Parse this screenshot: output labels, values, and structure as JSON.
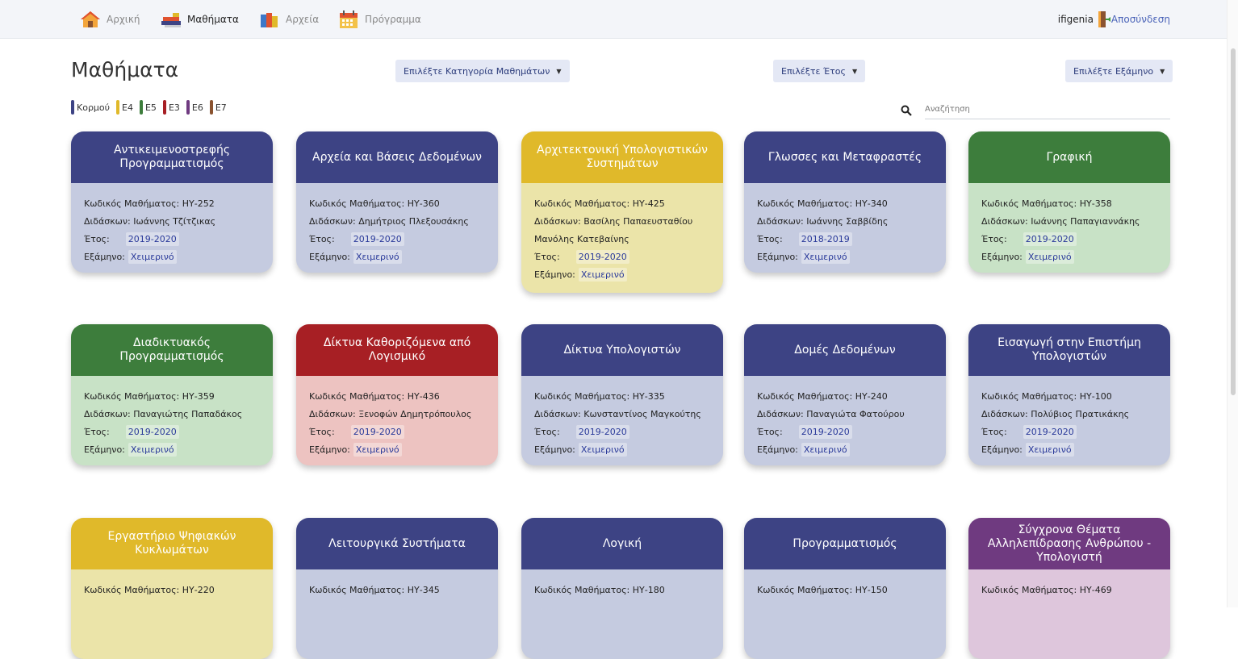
{
  "nav": {
    "items": [
      {
        "label": "Αρχική",
        "icon": "home-icon"
      },
      {
        "label": "Μαθήματα",
        "icon": "books-icon"
      },
      {
        "label": "Αρχεία",
        "icon": "files-icon"
      },
      {
        "label": "Πρόγραμμα",
        "icon": "calendar-icon"
      }
    ],
    "user": "ifigenia",
    "logout": "Αποσύνδεση"
  },
  "page": {
    "title": "Μαθήματα",
    "category_dropdown": "Επιλέξτε Κατηγορία Μαθημάτων",
    "year_dropdown": "Επιλέξτε Έτος",
    "semester_dropdown": "Επιλέξτε Εξάμηνο",
    "search_placeholder": "Αναζήτηση"
  },
  "legend": [
    {
      "label": "Κορμού",
      "color": "#3d4384"
    },
    {
      "label": "Ε4",
      "color": "#e0b92a"
    },
    {
      "label": "Ε5",
      "color": "#3d7d3c"
    },
    {
      "label": "Ε3",
      "color": "#a71f24"
    },
    {
      "label": "Ε6",
      "color": "#6f3a80"
    },
    {
      "label": "Ε7",
      "color": "#8a5330"
    }
  ],
  "labels": {
    "code": "Κωδικός Μαθήματος:",
    "teacher": "Διδάσκων:",
    "year": "Έτος:",
    "semester": "Εξάμηνο:"
  },
  "courses": [
    {
      "title": "Αντικειμενοστρεφής Προγραμματισμός",
      "code": "ΗΥ-252",
      "teacher": "Ιωάννης Τζίτζικας",
      "teacher2": "",
      "year": "2019-2020",
      "semester": "Χειμερινό",
      "head": "#3d4384",
      "body": "#c5cbe0"
    },
    {
      "title": "Αρχεία και Βάσεις Δεδομένων",
      "code": "ΗΥ-360",
      "teacher": "Δημήτριος Πλεξουσάκης",
      "teacher2": "",
      "year": "2019-2020",
      "semester": "Χειμερινό",
      "head": "#3d4384",
      "body": "#c5cbe0"
    },
    {
      "title": "Αρχιτεκτονική Υπολογιστικών Συστημάτων",
      "code": "ΗΥ-425",
      "teacher": "Βασίλης Παπαευσταθίου",
      "teacher2": "Μανόλης Κατεβαίνης",
      "year": "2019-2020",
      "semester": "Χειμερινό",
      "head": "#e0b92a",
      "body": "#ebe4a9"
    },
    {
      "title": "Γλωσσες και Μεταφραστές",
      "code": "ΗΥ-340",
      "teacher": "Ιωάννης Σαββίδης",
      "teacher2": "",
      "year": "2018-2019",
      "semester": "Χειμερινό",
      "head": "#3d4384",
      "body": "#c5cbe0"
    },
    {
      "title": "Γραφική",
      "code": "ΗΥ-358",
      "teacher": "Ιωάννης Παπαγιαννάκης",
      "teacher2": "",
      "year": "2019-2020",
      "semester": "Χειμερινό",
      "head": "#3d7d3c",
      "body": "#c8e2c6"
    },
    {
      "title": "Διαδικτυακός Προγραμματισμός",
      "code": "ΗΥ-359",
      "teacher": "Παναγιώτης Παπαδάκος",
      "teacher2": "",
      "year": "2019-2020",
      "semester": "Χειμερινό",
      "head": "#3d7d3c",
      "body": "#c8e2c6"
    },
    {
      "title": "Δίκτυα Καθοριζόμενα από Λογισμικό",
      "code": "ΗΥ-436",
      "teacher": "Ξενοφών Δημητρόπουλος",
      "teacher2": "",
      "year": "2019-2020",
      "semester": "Χειμερινό",
      "head": "#a71f24",
      "body": "#edc3c1"
    },
    {
      "title": "Δίκτυα Υπολογιστών",
      "code": "ΗΥ-335",
      "teacher": "Κωνσταντίνος Μαγκούτης",
      "teacher2": "",
      "year": "2019-2020",
      "semester": "Χειμερινό",
      "head": "#3d4384",
      "body": "#c5cbe0"
    },
    {
      "title": "Δομές Δεδομένων",
      "code": "ΗΥ-240",
      "teacher": "Παναγιώτα Φατούρου",
      "teacher2": "",
      "year": "2019-2020",
      "semester": "Χειμερινό",
      "head": "#3d4384",
      "body": "#c5cbe0"
    },
    {
      "title": "Εισαγωγή στην Επιστήμη Υπολογιστών",
      "code": "ΗΥ-100",
      "teacher": "Πολύβιος Πρατικάκης",
      "teacher2": "",
      "year": "2019-2020",
      "semester": "Χειμερινό",
      "head": "#3d4384",
      "body": "#c5cbe0"
    },
    {
      "title": "Εργαστήριο Ψηφιακών Κυκλωμάτων",
      "code": "ΗΥ-220",
      "teacher": "",
      "teacher2": "",
      "year": "",
      "semester": "",
      "head": "#e0b92a",
      "body": "#ebe4a9"
    },
    {
      "title": "Λειτουργικά Συστήματα",
      "code": "ΗΥ-345",
      "teacher": "",
      "teacher2": "",
      "year": "",
      "semester": "",
      "head": "#3d4384",
      "body": "#c5cbe0"
    },
    {
      "title": "Λογική",
      "code": "ΗΥ-180",
      "teacher": "",
      "teacher2": "",
      "year": "",
      "semester": "",
      "head": "#3d4384",
      "body": "#c5cbe0"
    },
    {
      "title": "Προγραμματισμός",
      "code": "ΗΥ-150",
      "teacher": "",
      "teacher2": "",
      "year": "",
      "semester": "",
      "head": "#3d4384",
      "body": "#c5cbe0"
    },
    {
      "title": "Σύγχρονα Θέματα Αλληλεπίδρασης Ανθρώπου - Υπολογιστή",
      "code": "ΗΥ-469",
      "teacher": "",
      "teacher2": "",
      "year": "",
      "semester": "",
      "head": "#6f3a80",
      "body": "#dec6dc"
    }
  ]
}
